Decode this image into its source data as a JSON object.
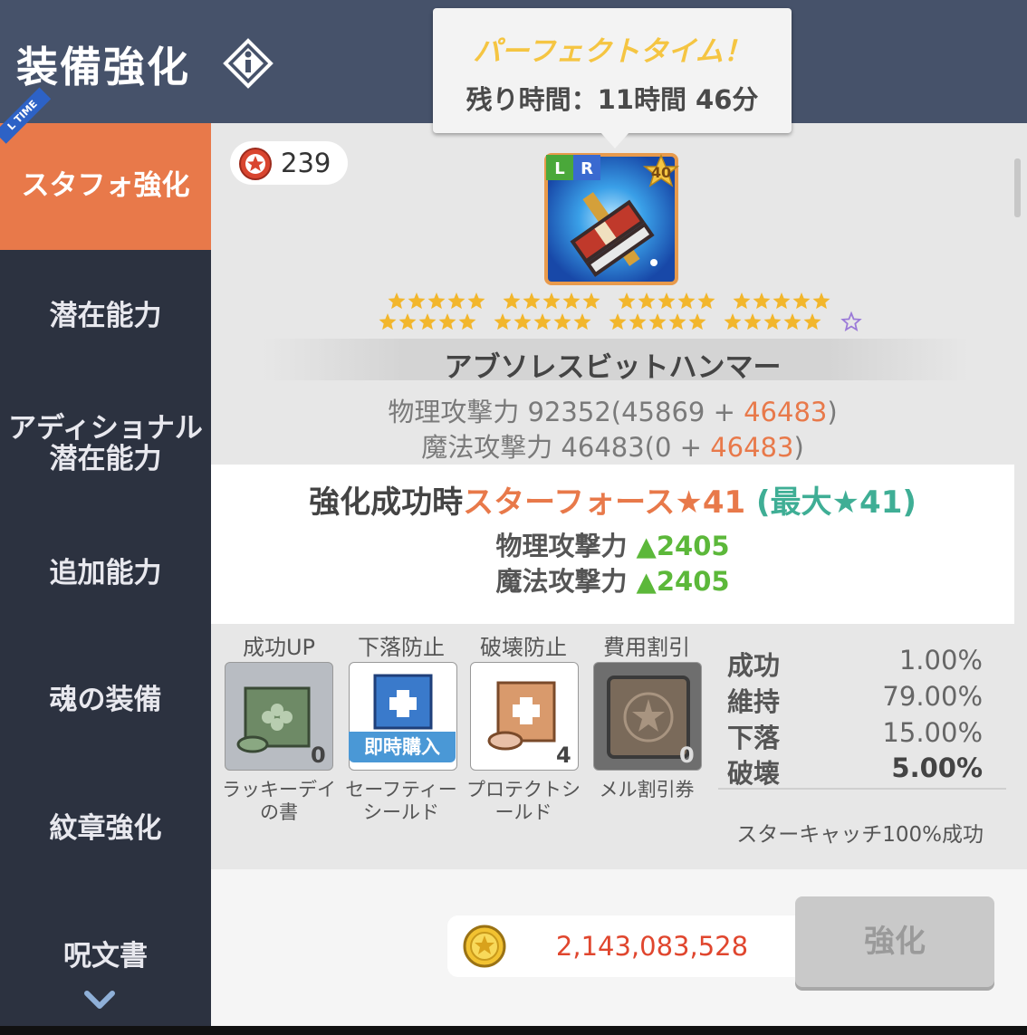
{
  "header": {
    "title": "装備強化"
  },
  "tooltip": {
    "title": "パーフェクトタイム！",
    "time": "残り時間：11時間 46分"
  },
  "sidebar": {
    "ribbon": "L TIME",
    "items": [
      {
        "label": "スタフォ強化"
      },
      {
        "label": "潜在能力"
      },
      {
        "label": "アディショナル潜在能力"
      },
      {
        "label": "追加能力"
      },
      {
        "label": "魂の装備"
      },
      {
        "label": "紋章強化"
      },
      {
        "label": "呪文書"
      }
    ]
  },
  "currency": {
    "value": "239"
  },
  "item": {
    "badge_l": "L",
    "badge_r": "R",
    "level": "40",
    "star_count": 40,
    "name": "アブソレスビットハンマー",
    "phys_label": "物理攻撃力 92352(45869 + ",
    "phys_bonus": "46483",
    "magic_label": "魔法攻撃力 46483(0 + ",
    "magic_bonus": "46483",
    "close_paren": ")"
  },
  "result": {
    "prefix": "強化成功時",
    "starforce": "スターフォース★41",
    "max": "(最大★41)",
    "phys_label": "物理攻撃力 ",
    "phys_gain": "▲2405",
    "magic_label": "魔法攻撃力 ",
    "magic_gain": "▲2405"
  },
  "options": [
    {
      "header": "成功UP",
      "name": "ラッキーデイの書",
      "count": "0"
    },
    {
      "header": "下落防止",
      "name": "セーフティーシールド",
      "badge": "即時購入"
    },
    {
      "header": "破壊防止",
      "name": "プロテクトシールド",
      "count": "4"
    },
    {
      "header": "費用割引",
      "name": "メル割引券",
      "count": "0"
    }
  ],
  "rates": [
    {
      "label": "成功",
      "value": "1.00%"
    },
    {
      "label": "維持",
      "value": "79.00%"
    },
    {
      "label": "下落",
      "value": "15.00%"
    },
    {
      "label": "破壊",
      "value": "5.00%"
    }
  ],
  "starcatch": "スターキャッチ100%成功",
  "cost": {
    "value": "2,143,083,528"
  },
  "enhance_button": "強化",
  "colors": {
    "accent": "#e8794a",
    "header": "#46526a",
    "sidebar": "#2c3240",
    "gain": "#5cb83a",
    "max": "#3fae95"
  }
}
